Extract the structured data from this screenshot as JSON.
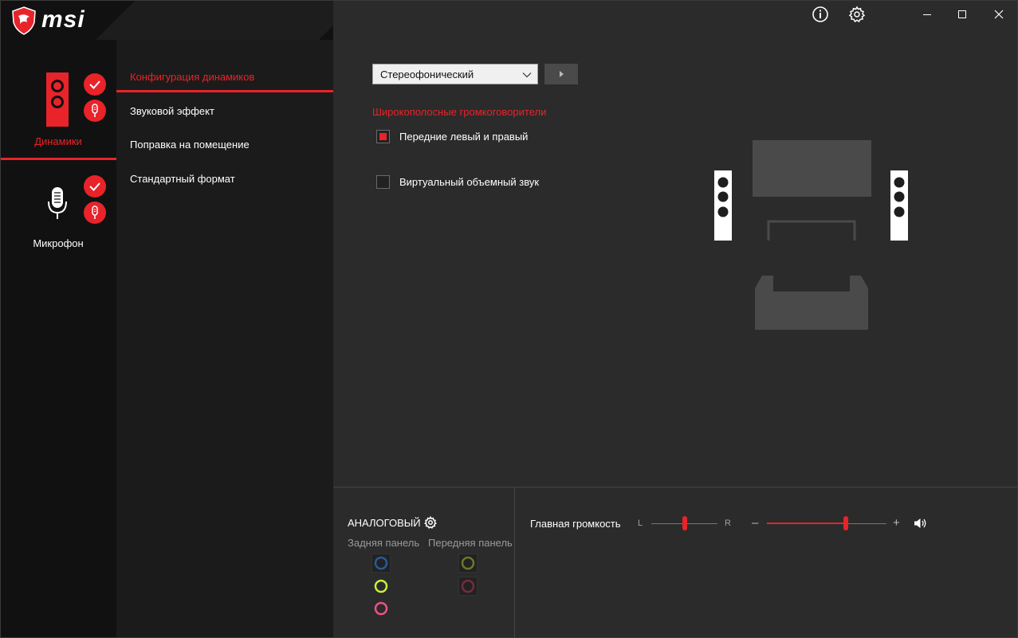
{
  "brand": {
    "name": "msi",
    "accent": "#e8232a"
  },
  "titlebar": {
    "info_icon": "info-circle-icon",
    "settings_icon": "gear-icon",
    "minimize_icon": "minimize-icon",
    "maximize_icon": "maximize-icon",
    "close_icon": "close-icon"
  },
  "devices": [
    {
      "label": "Динамики",
      "icon": "speaker-icon",
      "active": true
    },
    {
      "label": "Микрофон",
      "icon": "microphone-icon",
      "active": false
    }
  ],
  "nav": {
    "items": [
      {
        "label": "Конфигурация динамиков",
        "active": true
      },
      {
        "label": "Звуковой эффект",
        "active": false
      },
      {
        "label": "Поправка на помещение",
        "active": false
      },
      {
        "label": "Стандартный формат",
        "active": false
      }
    ]
  },
  "main": {
    "config_select": {
      "value": "Стереофонический"
    },
    "section_title": "Широкополосные громкоговорители",
    "options": [
      {
        "label": "Передние левый и правый",
        "checked": true
      },
      {
        "label": "Виртуальный объемный звук",
        "checked": false
      }
    ]
  },
  "bottom": {
    "analog_title": "АНАЛОГОВЫЙ",
    "rear_panel": "Задняя панель",
    "front_panel": "Передняя панель",
    "jack_colors": {
      "rear": [
        "#2a5a9a",
        "#c8f03c",
        "#f0508a"
      ],
      "front": [
        "#6a7a2a",
        "#7a2a3a"
      ]
    },
    "volume": {
      "label": "Главная громкость",
      "balance_left": "L",
      "balance_right": "R",
      "balance_value": 0.5,
      "minus": "–",
      "plus": "+",
      "level": 0.66
    }
  }
}
